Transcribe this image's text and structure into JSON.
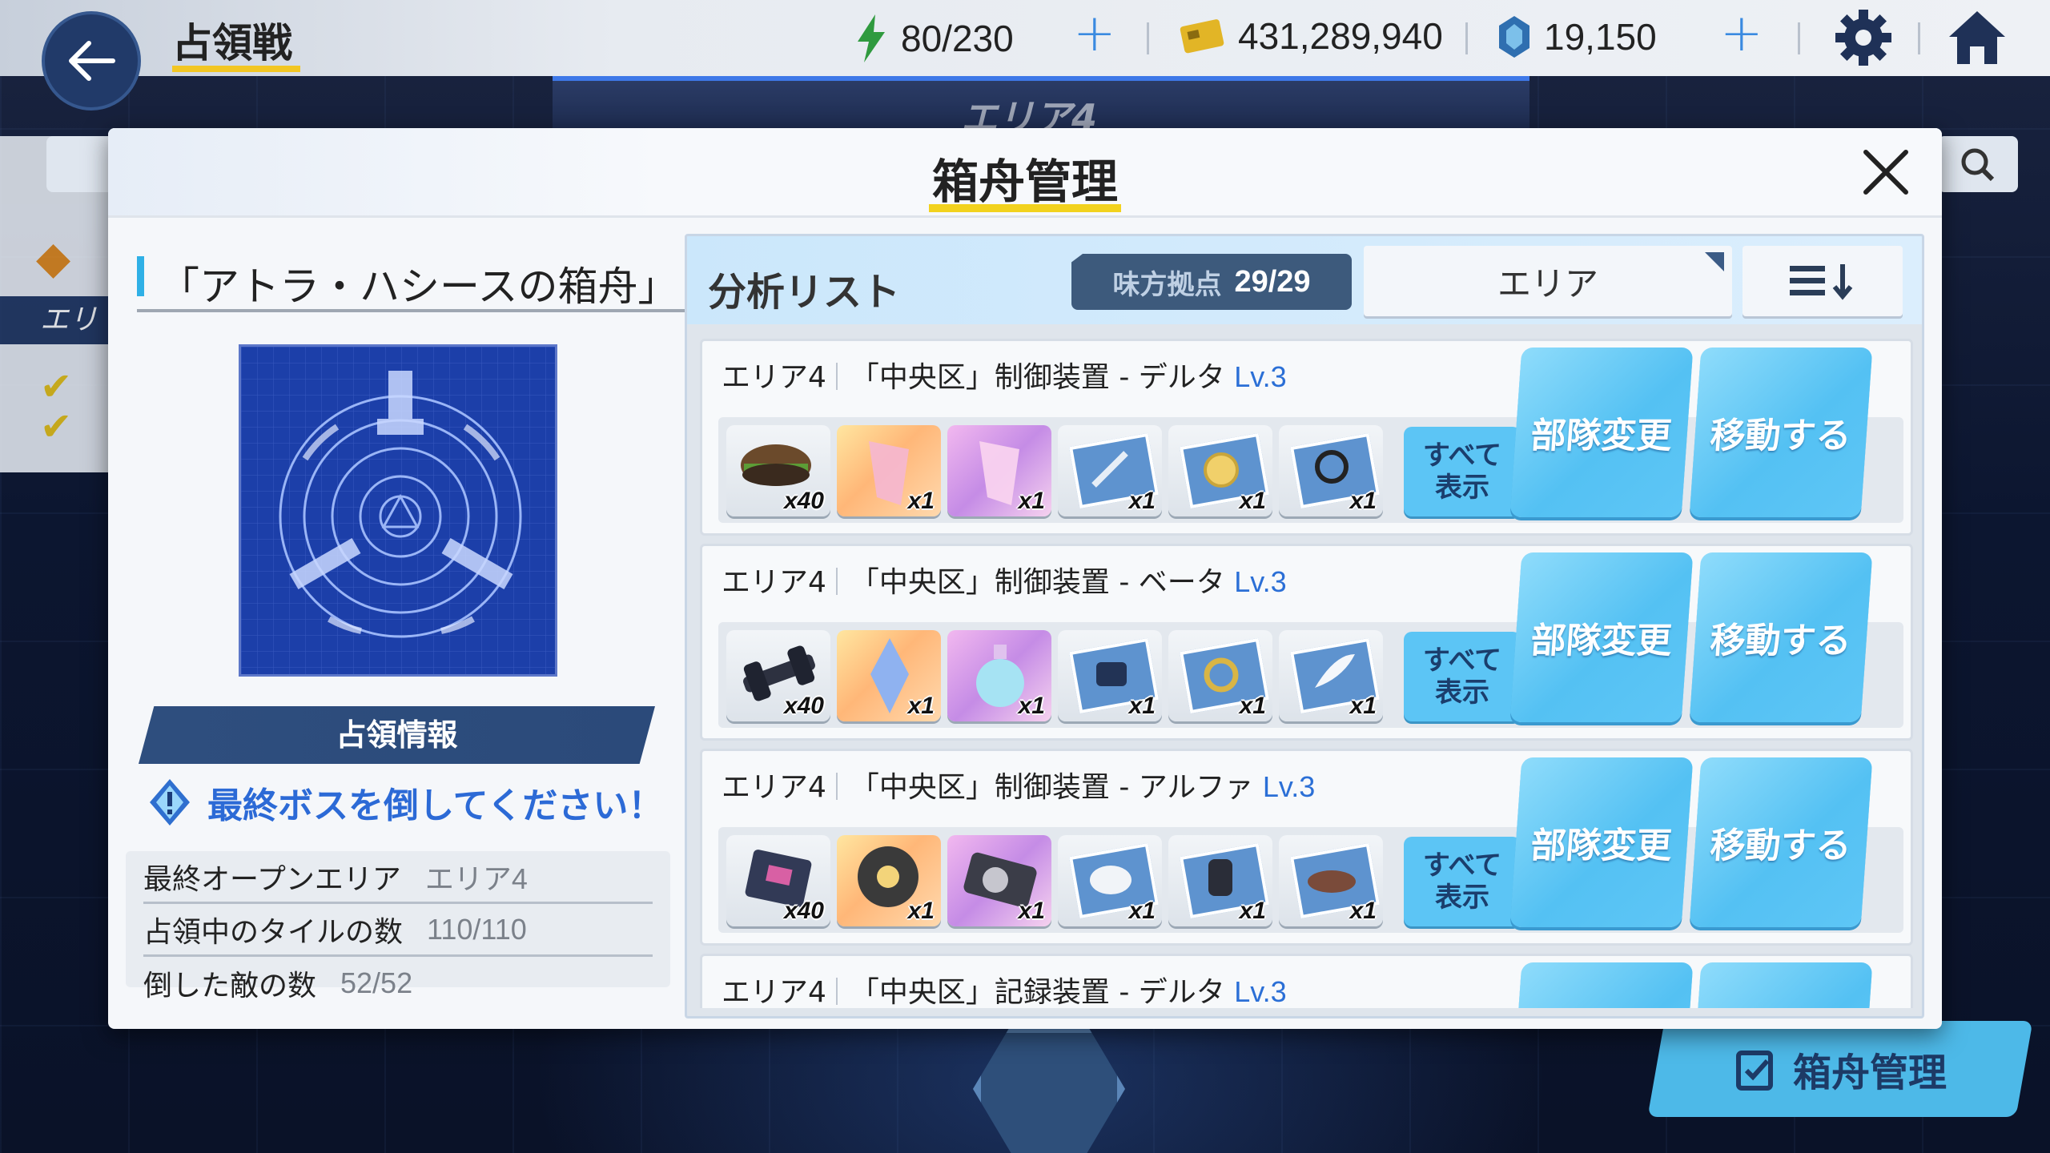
{
  "topbar": {
    "title": "占領戦",
    "stamina": "80/230",
    "credits": "431,289,940",
    "gems": "19,150"
  },
  "background": {
    "area_tab": "エリア4",
    "ark_button": "箱舟管理"
  },
  "modal": {
    "title": "箱舟管理",
    "ark_name": "「アトラ・ハシースの箱舟」",
    "occupy_header": "占領情報",
    "boss_message": "最終ボスを倒してください！",
    "stats": [
      {
        "label": "最終オープンエリア",
        "value": "エリア4"
      },
      {
        "label": "占領中のタイルの数",
        "value": "110/110"
      },
      {
        "label": "倒した敵の数",
        "value": "52/52"
      }
    ]
  },
  "analysis": {
    "title": "分析リスト",
    "allies_label": "味方拠点",
    "allies_value": "29/29",
    "area_select": "エリア",
    "show_all": "すべて\n表示",
    "change_squad": "部隊変更",
    "move": "移動する",
    "devices": [
      {
        "area": "エリア4",
        "name": "「中央区」制御装置 - デルタ",
        "level": "Lv.3",
        "rewards": [
          "x40",
          "x1",
          "x1",
          "x1",
          "x1",
          "x1"
        ]
      },
      {
        "area": "エリア4",
        "name": "「中央区」制御装置 - ベータ",
        "level": "Lv.3",
        "rewards": [
          "x40",
          "x1",
          "x1",
          "x1",
          "x1",
          "x1"
        ]
      },
      {
        "area": "エリア4",
        "name": "「中央区」制御装置 - アルファ",
        "level": "Lv.3",
        "rewards": [
          "x40",
          "x1",
          "x1",
          "x1",
          "x1",
          "x1"
        ]
      },
      {
        "area": "エリア4",
        "name": "「中央区」記録装置 - デルタ",
        "level": "Lv.3",
        "rewards": []
      }
    ]
  },
  "colors": {
    "accent_blue": "#5cc5f5",
    "title_underline": "#f2d21e",
    "level_blue": "#2b6fd6",
    "boss_msg_blue": "#2c6ad6"
  }
}
